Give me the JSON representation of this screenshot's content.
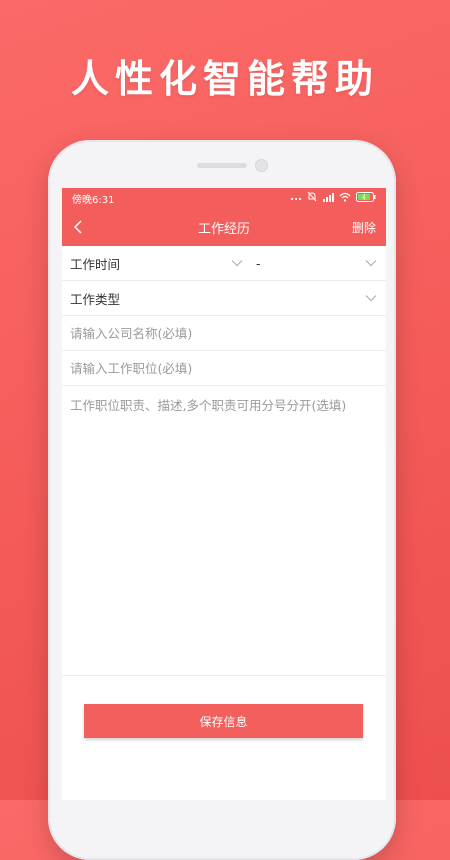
{
  "promo": {
    "headline": "人性化智能帮助"
  },
  "status_bar": {
    "time": "傍晚6:31"
  },
  "app_bar": {
    "title": "工作经历",
    "delete_label": "删除"
  },
  "form": {
    "work_time": {
      "label": "工作时间",
      "separator": "-"
    },
    "work_type": {
      "label": "工作类型"
    },
    "company": {
      "placeholder": "请输入公司名称(必填)"
    },
    "position": {
      "placeholder": "请输入工作职位(必填)"
    },
    "description": {
      "placeholder": "工作职位职责、描述,多个职责可用分号分开(选填)"
    }
  },
  "save_button": {
    "label": "保存信息"
  },
  "colors": {
    "accent": "#f35e5c",
    "background": "#f45b59",
    "text": "#333333",
    "placeholder": "#9a9a9a"
  },
  "icons": [
    "back-arrow-icon",
    "chevron-down-icon",
    "more-dots-icon",
    "mute-bell-icon",
    "signal-icon",
    "wifi-icon",
    "battery-icon"
  ]
}
